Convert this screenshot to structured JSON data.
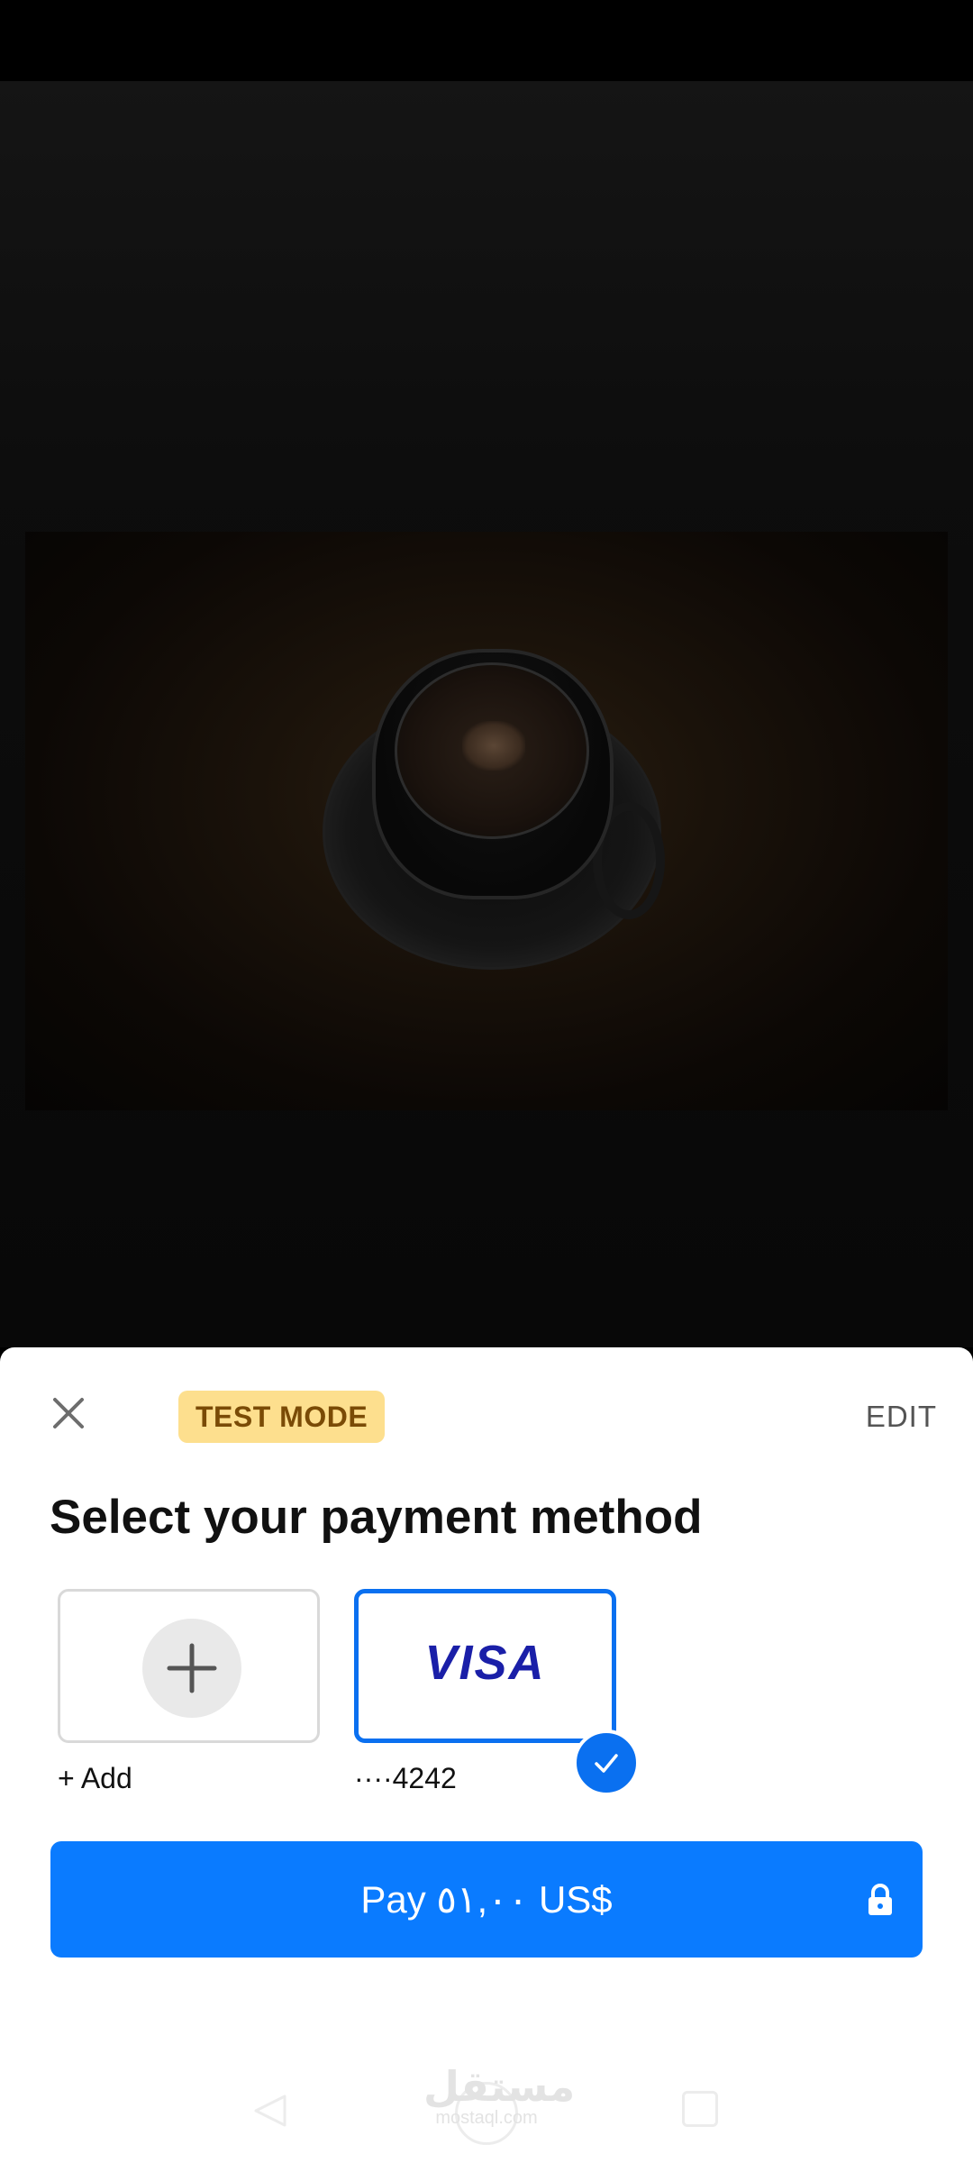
{
  "sheet": {
    "close_icon": "close-icon",
    "badge": "TEST MODE",
    "edit_label": "EDIT",
    "title": "Select your payment method"
  },
  "payment_methods": [
    {
      "label": "+ Add",
      "icon": "plus-icon",
      "selected": false
    },
    {
      "label": "····4242",
      "brand": "VISA",
      "icon": "visa-logo",
      "selected": true
    }
  ],
  "pay_button": {
    "label": "Pay ٥١,٠٠ US$",
    "icon": "lock-icon"
  },
  "watermark": {
    "arabic": "مستقل",
    "latin": "mostaql.com"
  },
  "colors": {
    "accent": "#0a7bff",
    "badge_bg": "#fddf8e",
    "badge_text": "#7a4b06",
    "visa_blue": "#1a1fa8"
  }
}
